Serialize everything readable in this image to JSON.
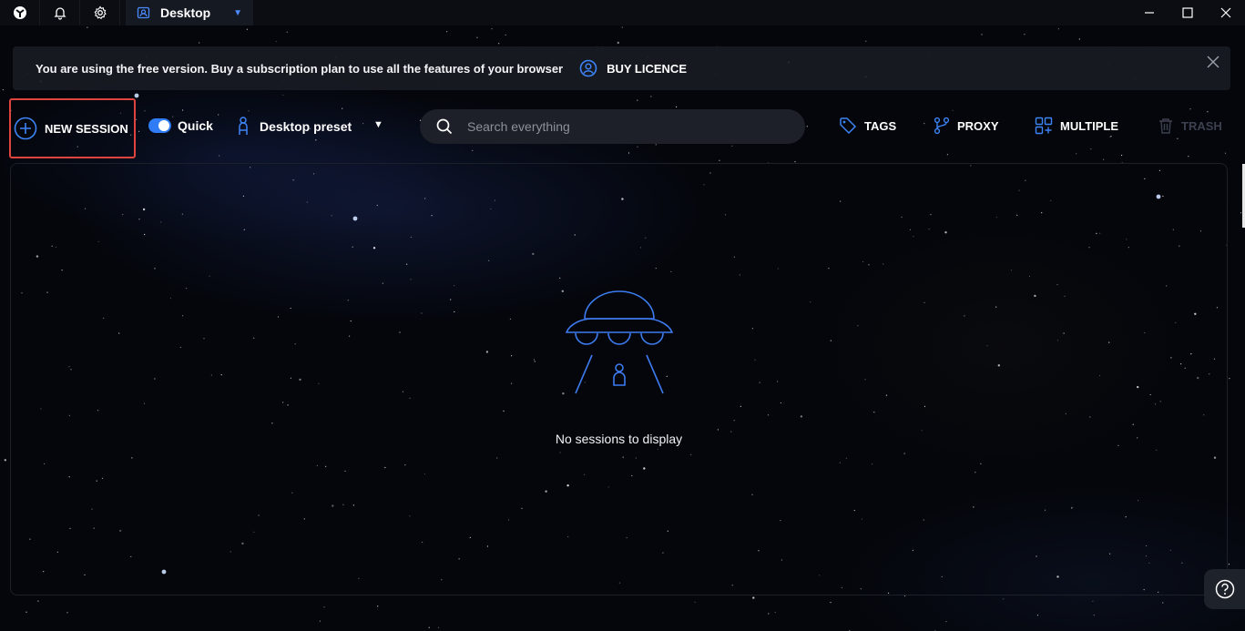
{
  "titlebar": {
    "tab_label": "Desktop",
    "icons": [
      "app-logo-icon",
      "bell-icon",
      "gear-icon",
      "desktop-profile-icon"
    ],
    "window_controls": [
      "minimize-icon",
      "maximize-icon",
      "close-icon"
    ]
  },
  "banner": {
    "text": "You are using the free version. Buy a subscription plan to use all the features of your browser",
    "buy_label": "BUY LICENCE"
  },
  "toolbar": {
    "new_session_label": "NEW SESSION",
    "quick_label": "Quick",
    "quick_enabled": true,
    "preset_label": "Desktop preset",
    "search_placeholder": "Search everything",
    "tags_label": "TAGS",
    "proxy_label": "PROXY",
    "multiple_label": "MULTIPLE",
    "trash_label": "TRASH"
  },
  "main": {
    "empty_text": "No sessions to display"
  },
  "colors": {
    "accent": "#2f7cf6",
    "highlight_border": "#e0443e",
    "ufo_stroke": "#3d7bf0"
  }
}
